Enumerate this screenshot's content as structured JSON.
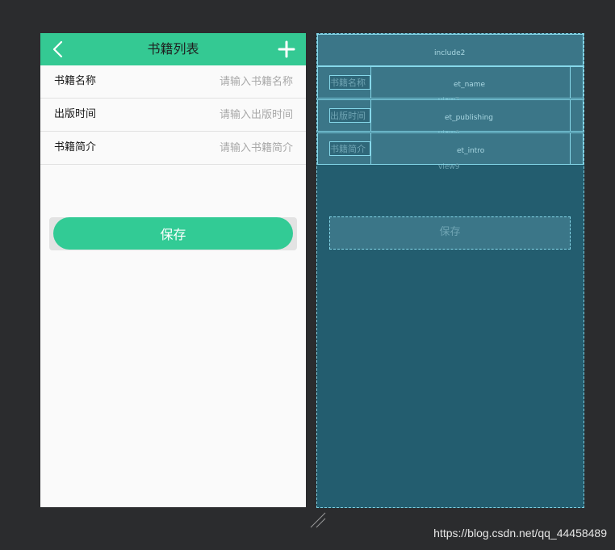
{
  "app": {
    "title": "书籍列表",
    "accent": "#34c993"
  },
  "form": {
    "name_label": "书籍名称",
    "name_placeholder": "请输入书籍名称",
    "publishing_label": "出版时间",
    "publishing_placeholder": "请输入出版时间",
    "intro_label": "书籍简介",
    "intro_placeholder": "请输入书籍简介",
    "save_label": "保存"
  },
  "blueprint": {
    "include_label": "include2",
    "name_label": "书籍名称",
    "name_id": "et_name",
    "view7": "view7",
    "publishing_label": "出版时间",
    "publishing_id": "et_publishing",
    "view8": "view8",
    "intro_label": "书籍简介",
    "intro_id": "et_intro",
    "view9": "view9",
    "save_label": "保存"
  },
  "watermark": "https://blog.csdn.net/qq_44458489",
  "icons": {
    "back": "chevron-left-icon",
    "add": "plus-icon",
    "resize": "resize-handle-icon"
  }
}
